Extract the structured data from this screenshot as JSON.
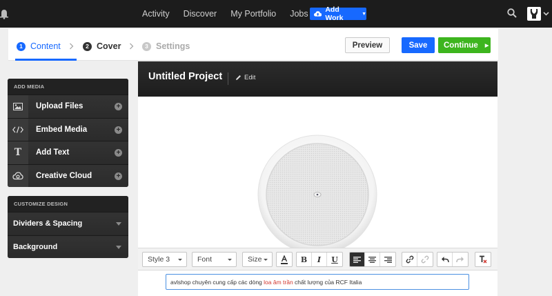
{
  "topnav": {
    "links": [
      "Activity",
      "Discover",
      "My Portfolio",
      "Jobs"
    ],
    "add_work_label": "Add Work"
  },
  "steps": [
    {
      "num": "1",
      "label": "Content"
    },
    {
      "num": "2",
      "label": "Cover"
    },
    {
      "num": "3",
      "label": "Settings"
    }
  ],
  "actions": {
    "preview_label": "Preview",
    "save_label": "Save",
    "continue_label": "Continue"
  },
  "add_media": {
    "heading": "ADD MEDIA",
    "items": [
      {
        "label": "Upload Files",
        "icon": "image-icon"
      },
      {
        "label": "Embed Media",
        "icon": "code-icon"
      },
      {
        "label": "Add Text",
        "icon": "text-icon"
      },
      {
        "label": "Creative Cloud",
        "icon": "creative-cloud-icon"
      }
    ]
  },
  "customize": {
    "heading": "CUSTOMIZE DESIGN",
    "items": [
      "Dividers & Spacing",
      "Background"
    ]
  },
  "project": {
    "title": "Untitled Project",
    "edit_label": "Edit"
  },
  "toolbar": {
    "style_value": "Style 3",
    "font_value": "Font",
    "size_value": "Size",
    "bold": "B",
    "italic": "I",
    "underline": "U"
  },
  "textbox": {
    "before": "avlshop chuyên cung cấp các dòng ",
    "link": "loa âm trần",
    "after": " chất lượng của RCF Italia"
  },
  "colors": {
    "accent_blue": "#1769ff",
    "continue_green": "#3db51e",
    "link_red": "#d0342c"
  }
}
